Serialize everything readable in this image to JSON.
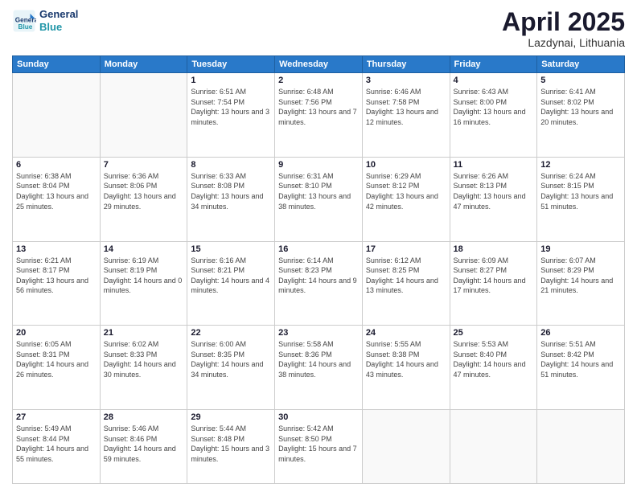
{
  "logo": {
    "line1": "General",
    "line2": "Blue"
  },
  "header": {
    "title": "April 2025",
    "subtitle": "Lazdynai, Lithuania"
  },
  "weekdays": [
    "Sunday",
    "Monday",
    "Tuesday",
    "Wednesday",
    "Thursday",
    "Friday",
    "Saturday"
  ],
  "weeks": [
    [
      {
        "day": "",
        "info": ""
      },
      {
        "day": "",
        "info": ""
      },
      {
        "day": "1",
        "info": "Sunrise: 6:51 AM\nSunset: 7:54 PM\nDaylight: 13 hours and 3 minutes."
      },
      {
        "day": "2",
        "info": "Sunrise: 6:48 AM\nSunset: 7:56 PM\nDaylight: 13 hours and 7 minutes."
      },
      {
        "day": "3",
        "info": "Sunrise: 6:46 AM\nSunset: 7:58 PM\nDaylight: 13 hours and 12 minutes."
      },
      {
        "day": "4",
        "info": "Sunrise: 6:43 AM\nSunset: 8:00 PM\nDaylight: 13 hours and 16 minutes."
      },
      {
        "day": "5",
        "info": "Sunrise: 6:41 AM\nSunset: 8:02 PM\nDaylight: 13 hours and 20 minutes."
      }
    ],
    [
      {
        "day": "6",
        "info": "Sunrise: 6:38 AM\nSunset: 8:04 PM\nDaylight: 13 hours and 25 minutes."
      },
      {
        "day": "7",
        "info": "Sunrise: 6:36 AM\nSunset: 8:06 PM\nDaylight: 13 hours and 29 minutes."
      },
      {
        "day": "8",
        "info": "Sunrise: 6:33 AM\nSunset: 8:08 PM\nDaylight: 13 hours and 34 minutes."
      },
      {
        "day": "9",
        "info": "Sunrise: 6:31 AM\nSunset: 8:10 PM\nDaylight: 13 hours and 38 minutes."
      },
      {
        "day": "10",
        "info": "Sunrise: 6:29 AM\nSunset: 8:12 PM\nDaylight: 13 hours and 42 minutes."
      },
      {
        "day": "11",
        "info": "Sunrise: 6:26 AM\nSunset: 8:13 PM\nDaylight: 13 hours and 47 minutes."
      },
      {
        "day": "12",
        "info": "Sunrise: 6:24 AM\nSunset: 8:15 PM\nDaylight: 13 hours and 51 minutes."
      }
    ],
    [
      {
        "day": "13",
        "info": "Sunrise: 6:21 AM\nSunset: 8:17 PM\nDaylight: 13 hours and 56 minutes."
      },
      {
        "day": "14",
        "info": "Sunrise: 6:19 AM\nSunset: 8:19 PM\nDaylight: 14 hours and 0 minutes."
      },
      {
        "day": "15",
        "info": "Sunrise: 6:16 AM\nSunset: 8:21 PM\nDaylight: 14 hours and 4 minutes."
      },
      {
        "day": "16",
        "info": "Sunrise: 6:14 AM\nSunset: 8:23 PM\nDaylight: 14 hours and 9 minutes."
      },
      {
        "day": "17",
        "info": "Sunrise: 6:12 AM\nSunset: 8:25 PM\nDaylight: 14 hours and 13 minutes."
      },
      {
        "day": "18",
        "info": "Sunrise: 6:09 AM\nSunset: 8:27 PM\nDaylight: 14 hours and 17 minutes."
      },
      {
        "day": "19",
        "info": "Sunrise: 6:07 AM\nSunset: 8:29 PM\nDaylight: 14 hours and 21 minutes."
      }
    ],
    [
      {
        "day": "20",
        "info": "Sunrise: 6:05 AM\nSunset: 8:31 PM\nDaylight: 14 hours and 26 minutes."
      },
      {
        "day": "21",
        "info": "Sunrise: 6:02 AM\nSunset: 8:33 PM\nDaylight: 14 hours and 30 minutes."
      },
      {
        "day": "22",
        "info": "Sunrise: 6:00 AM\nSunset: 8:35 PM\nDaylight: 14 hours and 34 minutes."
      },
      {
        "day": "23",
        "info": "Sunrise: 5:58 AM\nSunset: 8:36 PM\nDaylight: 14 hours and 38 minutes."
      },
      {
        "day": "24",
        "info": "Sunrise: 5:55 AM\nSunset: 8:38 PM\nDaylight: 14 hours and 43 minutes."
      },
      {
        "day": "25",
        "info": "Sunrise: 5:53 AM\nSunset: 8:40 PM\nDaylight: 14 hours and 47 minutes."
      },
      {
        "day": "26",
        "info": "Sunrise: 5:51 AM\nSunset: 8:42 PM\nDaylight: 14 hours and 51 minutes."
      }
    ],
    [
      {
        "day": "27",
        "info": "Sunrise: 5:49 AM\nSunset: 8:44 PM\nDaylight: 14 hours and 55 minutes."
      },
      {
        "day": "28",
        "info": "Sunrise: 5:46 AM\nSunset: 8:46 PM\nDaylight: 14 hours and 59 minutes."
      },
      {
        "day": "29",
        "info": "Sunrise: 5:44 AM\nSunset: 8:48 PM\nDaylight: 15 hours and 3 minutes."
      },
      {
        "day": "30",
        "info": "Sunrise: 5:42 AM\nSunset: 8:50 PM\nDaylight: 15 hours and 7 minutes."
      },
      {
        "day": "",
        "info": ""
      },
      {
        "day": "",
        "info": ""
      },
      {
        "day": "",
        "info": ""
      }
    ]
  ]
}
